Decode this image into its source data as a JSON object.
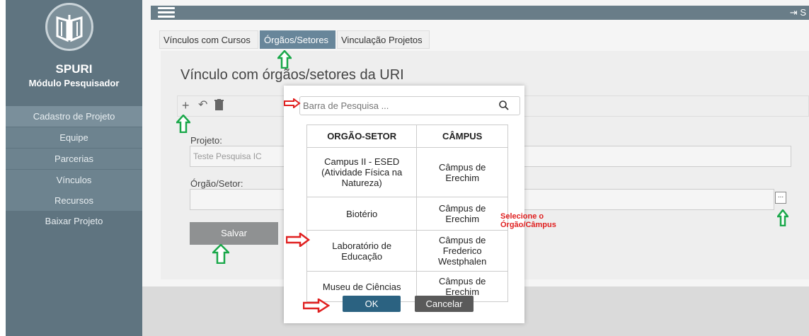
{
  "app": {
    "name": "SPURI",
    "subtitle": "Módulo Pesquisador"
  },
  "sidebar": {
    "items": [
      {
        "label": "Cadastro de Projeto"
      },
      {
        "label": "Equipe"
      },
      {
        "label": "Parcerias"
      },
      {
        "label": "Vínculos"
      },
      {
        "label": "Recursos"
      },
      {
        "label": "Baixar Projeto"
      }
    ]
  },
  "topbar": {
    "logout_label": "S"
  },
  "tabs": [
    {
      "label": "Vínculos com Cursos"
    },
    {
      "label": "Órgãos/Setores"
    },
    {
      "label": "Vinculação Projetos"
    }
  ],
  "main": {
    "title": "Vínculo com órgãos/setores da URI",
    "projeto_label": "Projeto:",
    "projeto_value": "Teste Pesquisa IC",
    "orgao_label": "Órgão/Setor:",
    "orgao_value": "",
    "dots_label": "...",
    "save_label": "Salvar"
  },
  "modal": {
    "search_placeholder": "Barra de Pesquisa ...",
    "columns": [
      "ORGÃO-SETOR",
      "CÂMPUS"
    ],
    "rows": [
      {
        "orgao": "Campus II - ESED (Atividade Física na Natureza)",
        "campus": "Câmpus de Erechim"
      },
      {
        "orgao": "Biotério",
        "campus": "Câmpus de Erechim"
      },
      {
        "orgao": "Laboratório de Educação",
        "campus": "Câmpus de Frederico Westphalen"
      },
      {
        "orgao": "Museu de Ciências",
        "campus": "Câmpus de Erechim"
      }
    ],
    "ok_label": "OK",
    "cancel_label": "Cancelar"
  },
  "annotations": {
    "note_line1": "Selecione o",
    "note_line2": "Órgão/Câmpus",
    "arrow_red": "#e02020",
    "arrow_green": "#1aa84a"
  }
}
